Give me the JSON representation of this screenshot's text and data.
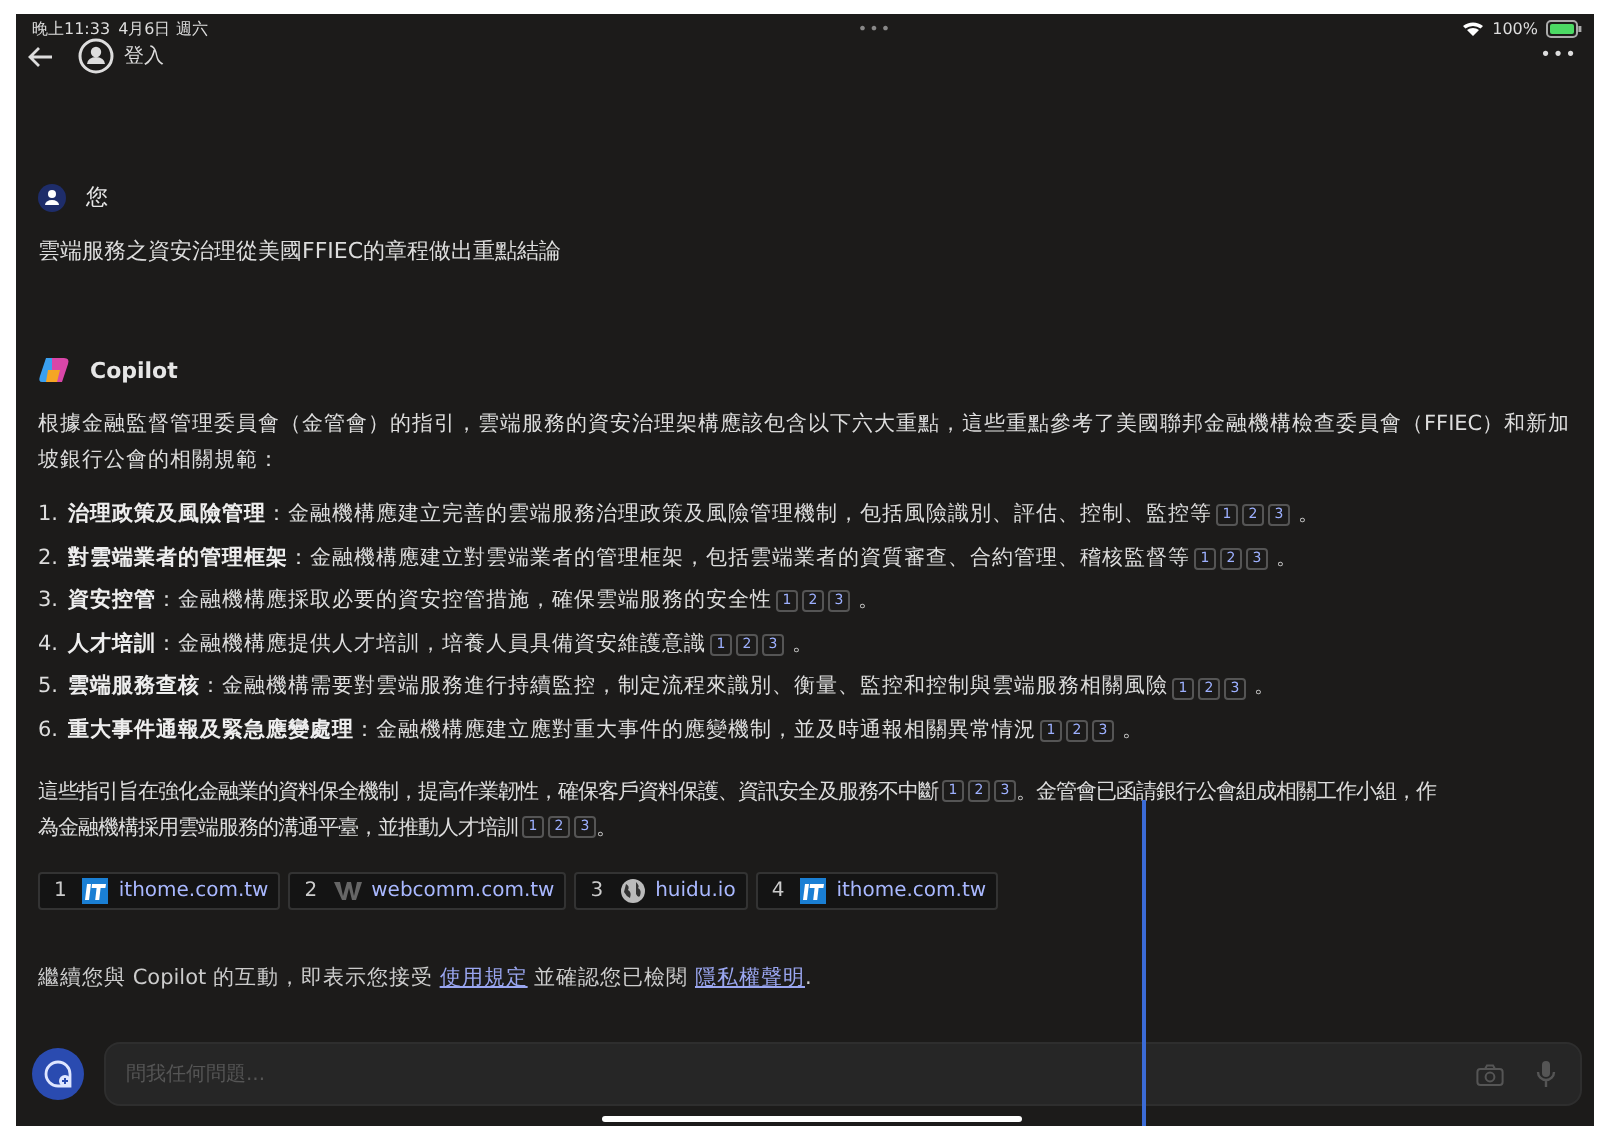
{
  "status_bar": {
    "time": "晚上11:33",
    "date": "4月6日 週六",
    "dots": "•••",
    "battery": "100%"
  },
  "nav": {
    "sign_in": "登入",
    "more": "•••"
  },
  "user_message": {
    "author": "您",
    "text": "雲端服務之資安治理從美國FFIEC的章程做出重點結論"
  },
  "reply": {
    "author": "Copilot",
    "intro": "根據金融監督管理委員會（金管會）的指引，雲端服務的資安治理架構應該包含以下六大重點，這些重點參考了美國聯邦金融機構檢查委員會（FFIEC）和新加坡銀行公會的相關規範：",
    "items": [
      {
        "number": "1.",
        "title": "治理政策及風險管理",
        "text": "：金融機構應建立完善的雲端服務治理政策及風險管理機制，包括風險識別、評估、控制、監控等",
        "citations": [
          "1",
          "2",
          "3"
        ],
        "end": "。"
      },
      {
        "number": "2.",
        "title": "對雲端業者的管理框架",
        "text": "：金融機構應建立對雲端業者的管理框架，包括雲端業者的資質審查、合約管理、稽核監督等",
        "citations": [
          "1",
          "2",
          "3"
        ],
        "end": "。"
      },
      {
        "number": "3.",
        "title": "資安控管",
        "text": "：金融機構應採取必要的資安控管措施，確保雲端服務的安全性",
        "citations": [
          "1",
          "2",
          "3"
        ],
        "end": "。"
      },
      {
        "number": "4.",
        "title": "人才培訓",
        "text": "：金融機構應提供人才培訓，培養人員具備資安維護意識",
        "citations": [
          "1",
          "2",
          "3"
        ],
        "end": "。"
      },
      {
        "number": "5.",
        "title": "雲端服務查核",
        "text": "：金融機構需要對雲端服務進行持續監控，制定流程來識別、衡量、監控和控制與雲端服務相關風險",
        "citations": [
          "1",
          "2",
          "3"
        ],
        "end": "。"
      },
      {
        "number": "6.",
        "title": "重大事件通報及緊急應變處理",
        "text": "：金融機構應建立應對重大事件的應變機制，並及時通報相關異常情況",
        "citations": [
          "1",
          "2",
          "3"
        ],
        "end": "。"
      }
    ],
    "conclusion": [
      [
        {
          "kind": "text",
          "text": "這些指引旨在強化金融業的資料保全機制，提高作業韌性，確保客戶資料保護、資訊安全及服務不中斷"
        },
        {
          "kind": "cite",
          "labels": [
            "1",
            "2",
            "3"
          ]
        },
        {
          "kind": "text",
          "text": "。金管會已函請銀行公會組成相關工作小組，作"
        }
      ],
      [
        {
          "kind": "text",
          "text": "為金融機構採用雲端服務的溝通平臺，並推動人才培訓"
        },
        {
          "kind": "cite",
          "labels": [
            "1",
            "2",
            "3"
          ]
        },
        {
          "kind": "text",
          "text": "。"
        }
      ]
    ],
    "sources": [
      {
        "number": "1",
        "kind": "it",
        "domain": "ithome.com.tw"
      },
      {
        "number": "2",
        "kind": "w",
        "domain": "webcomm.com.tw"
      },
      {
        "number": "3",
        "kind": "globe",
        "domain": "huidu.io"
      },
      {
        "number": "4",
        "kind": "it",
        "domain": "ithome.com.tw"
      }
    ]
  },
  "terms": {
    "before": "繼續您與 Copilot 的互動，即表示您接受",
    "link1": "使用規定",
    "middle": "並確認您已檢閱",
    "link2": "隱私權聲明",
    "after": "."
  },
  "composer": {
    "placeholder": "問我任何問題..."
  }
}
